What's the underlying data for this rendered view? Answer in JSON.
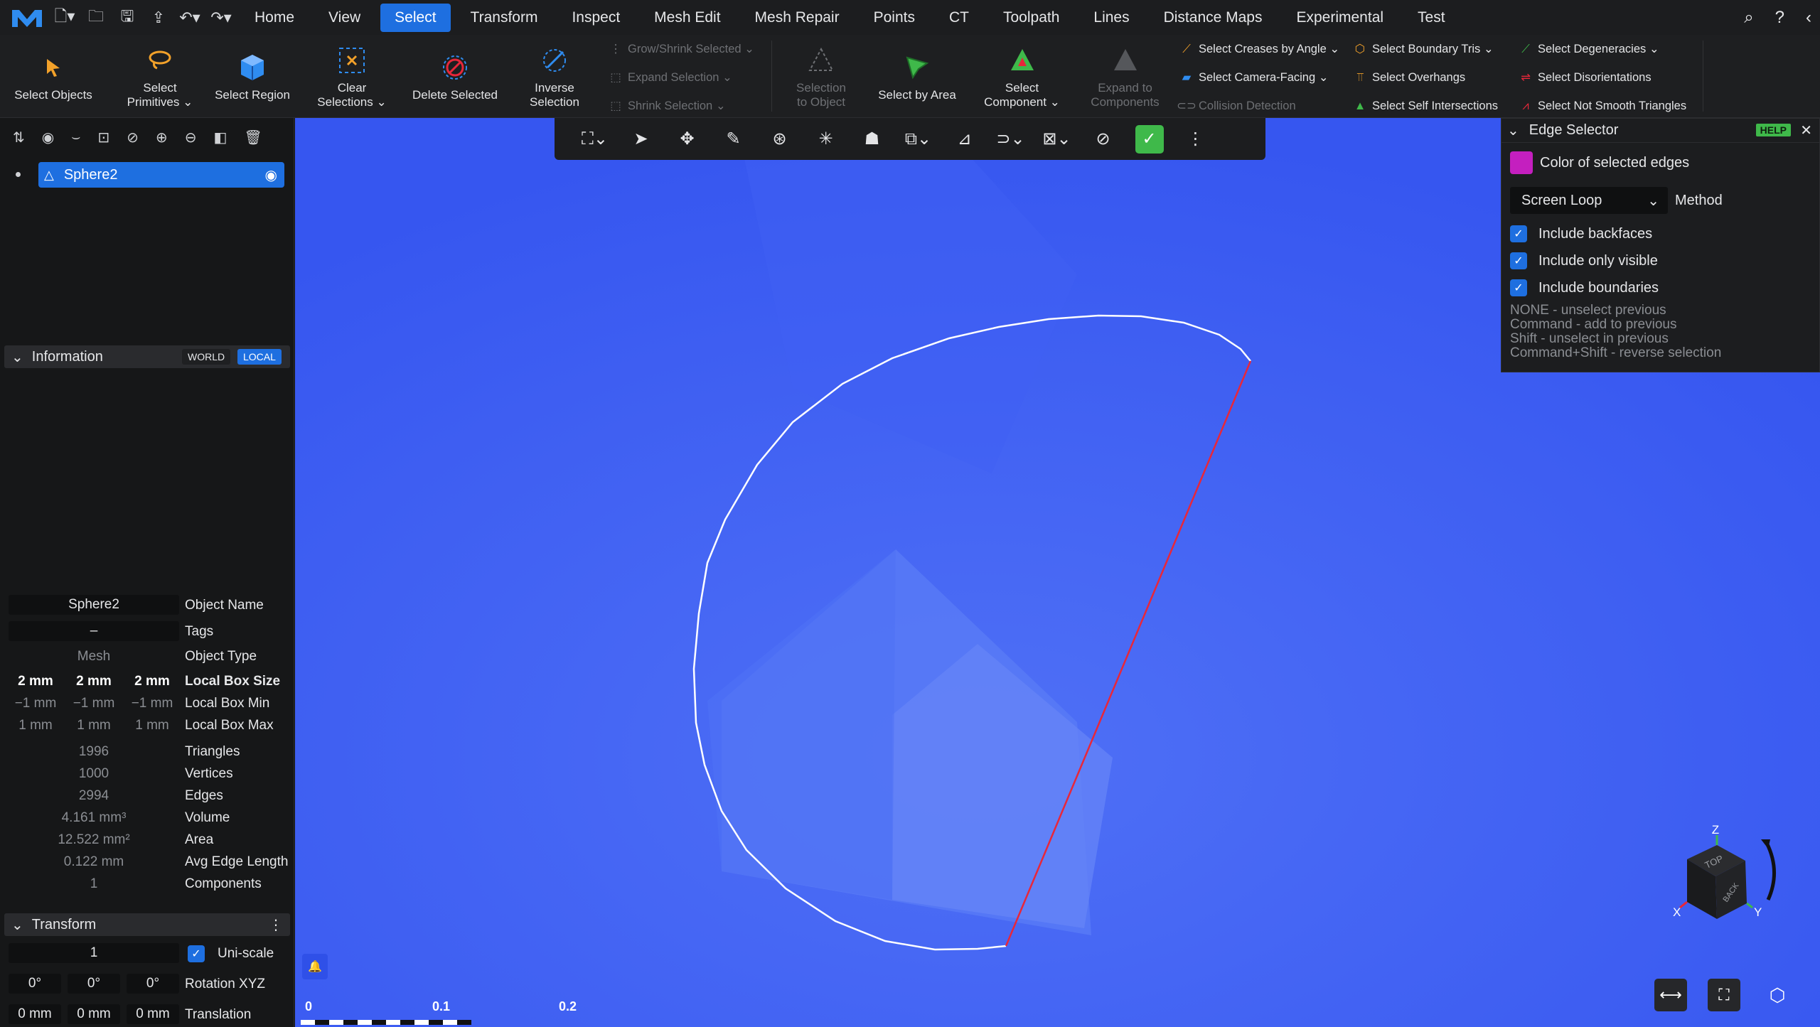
{
  "menu": {
    "tabs": [
      "Home",
      "View",
      "Select",
      "Transform",
      "Inspect",
      "Mesh Edit",
      "Mesh Repair",
      "Points",
      "CT",
      "Toolpath",
      "Lines",
      "Distance Maps",
      "Experimental",
      "Test"
    ],
    "active_tab": "Select"
  },
  "ribbon": {
    "select_objects": "Select Objects",
    "select_primitives_1": "Select",
    "select_primitives_2": "Primitives",
    "select_region": "Select Region",
    "clear_selections_1": "Clear",
    "clear_selections_2": "Selections",
    "delete_selected": "Delete Selected",
    "inverse_selection_1": "Inverse",
    "inverse_selection_2": "Selection",
    "grow_shrink": "Grow/Shrink Selected",
    "expand_selection": "Expand Selection",
    "shrink_selection": "Shrink Selection",
    "selection_to_object_1": "Selection",
    "selection_to_object_2": "to Object",
    "select_by_area": "Select by Area",
    "select_component_1": "Select",
    "select_component_2": "Component",
    "expand_to_components_1": "Expand to",
    "expand_to_components_2": "Components",
    "select_creases": "Select Creases by Angle",
    "select_camera_facing": "Select Camera-Facing",
    "collision_detection": "Collision Detection",
    "select_boundary_tris": "Select Boundary Tris",
    "select_overhangs": "Select Overhangs",
    "select_self_intersections": "Select Self Intersections",
    "select_degeneracies": "Select Degeneracies",
    "select_disorientations": "Select Disorientations",
    "select_not_smooth": "Select Not Smooth Triangles"
  },
  "tree": {
    "object": "Sphere2"
  },
  "info": {
    "header": "Information",
    "world": "WORLD",
    "local": "LOCAL",
    "object_name_value": "Sphere2",
    "object_name_label": "Object Name",
    "tags_value": "–",
    "tags_label": "Tags",
    "object_type_value": "Mesh",
    "object_type_label": "Object Type",
    "box_size": [
      "2 mm",
      "2 mm",
      "2 mm"
    ],
    "box_size_label": "Local Box Size",
    "box_min": [
      "−1 mm",
      "−1 mm",
      "−1 mm"
    ],
    "box_min_label": "Local Box Min",
    "box_max": [
      "1 mm",
      "1 mm",
      "1 mm"
    ],
    "box_max_label": "Local Box Max",
    "triangles": "1996",
    "triangles_label": "Triangles",
    "vertices": "1000",
    "vertices_label": "Vertices",
    "edges": "2994",
    "edges_label": "Edges",
    "volume": "4.161 mm³",
    "volume_label": "Volume",
    "area": "12.522 mm²",
    "area_label": "Area",
    "avg_edge": "0.122 mm",
    "avg_edge_label": "Avg Edge Length",
    "components": "1",
    "components_label": "Components"
  },
  "transform": {
    "header": "Transform",
    "scale": "1",
    "uniscale_label": "Uni-scale",
    "rotation": [
      "0°",
      "0°",
      "0°"
    ],
    "rotation_label": "Rotation XYZ",
    "translation": [
      "0 mm",
      "0 mm",
      "0 mm"
    ],
    "translation_label": "Translation"
  },
  "edge_selector": {
    "title": "Edge Selector",
    "help": "HELP",
    "color_label": "Color of selected edges",
    "color": "#c41fbf",
    "method_value": "Screen Loop",
    "method_label": "Method",
    "include_backfaces": "Include backfaces",
    "include_only_visible": "Include only visible",
    "include_boundaries": "Include boundaries",
    "hint1": "NONE - unselect previous",
    "hint2": "Command - add to previous",
    "hint3": "Shift - unselect in previous",
    "hint4": "Command+Shift - reverse selection"
  },
  "ruler": {
    "labels": [
      "0",
      "0.1",
      "0.2"
    ]
  },
  "gizmo": {
    "z": "Z",
    "x": "X",
    "y": "Y",
    "top": "TOP",
    "back": "BACK"
  },
  "colors": {
    "accent": "#1e6fe0",
    "viewport": "#3a5cf2",
    "selected_edge": "#e8273a",
    "loop": "#ffffff"
  }
}
